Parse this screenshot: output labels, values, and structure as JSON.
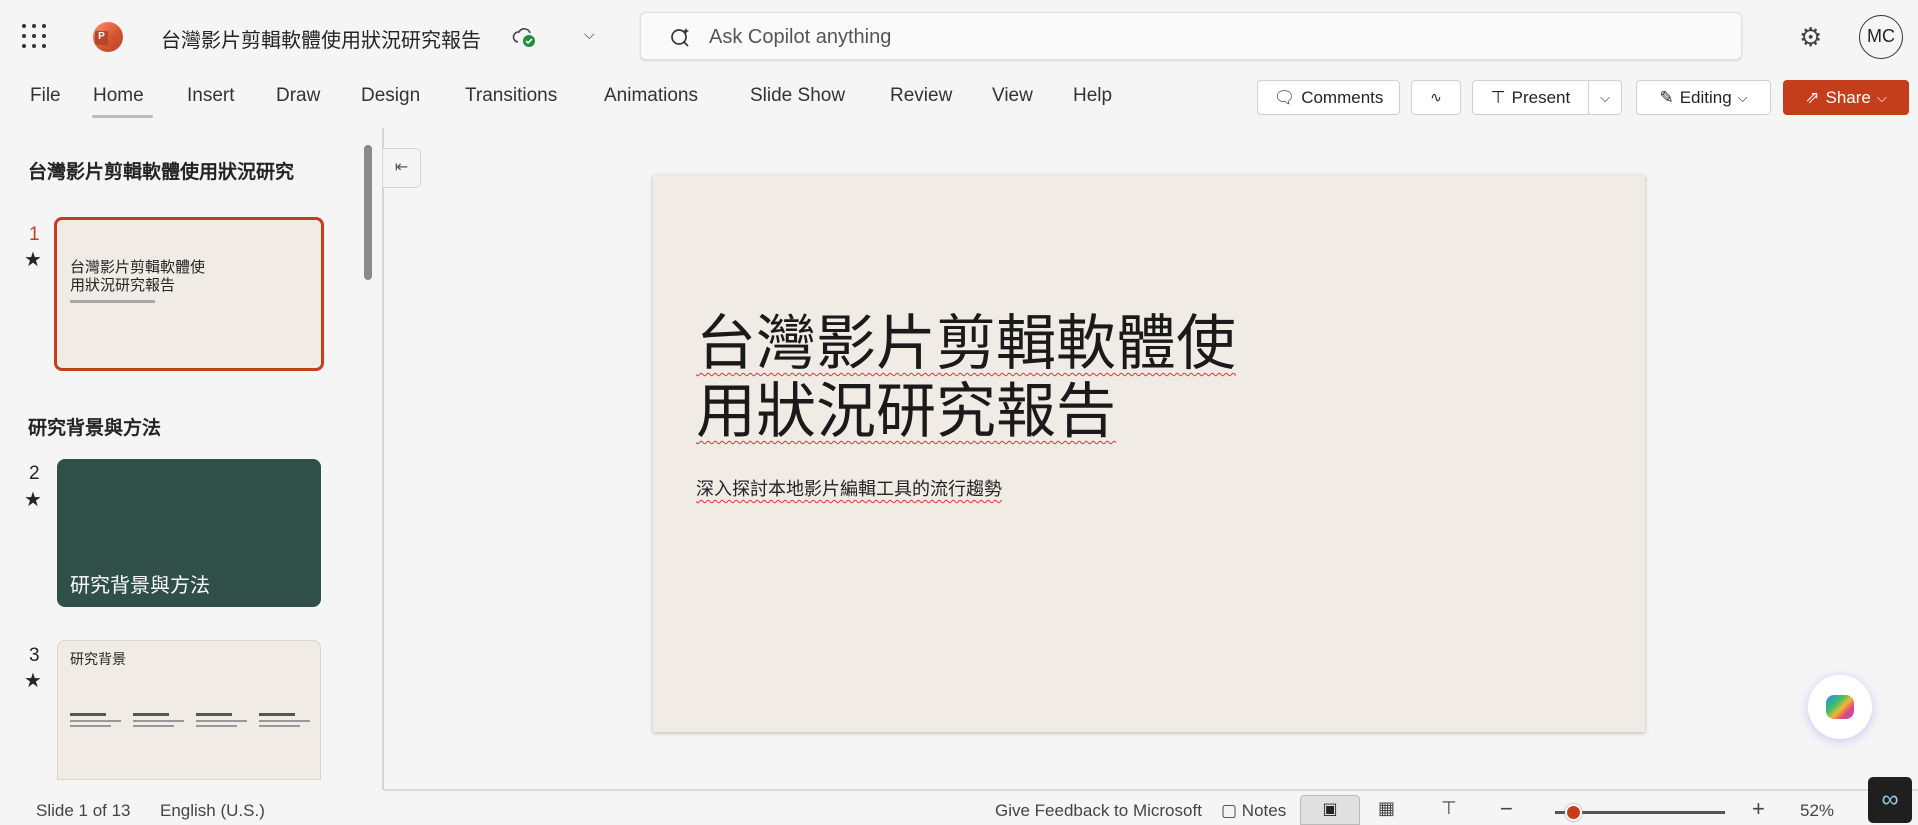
{
  "app": {
    "doc_title": "台灣影片剪輯軟體使用狀況研究報告",
    "search_placeholder": "Ask Copilot anything",
    "avatar": "MC",
    "accent": "#c43e1c"
  },
  "ribbon": {
    "tabs": [
      "File",
      "Home",
      "Insert",
      "Draw",
      "Design",
      "Transitions",
      "Animations",
      "Slide Show",
      "Review",
      "View",
      "Help"
    ],
    "active": "Home",
    "comments": "Comments",
    "present": "Present",
    "editing": "Editing",
    "share": "Share"
  },
  "slides_pane": {
    "sections": [
      "台灣影片剪輯軟體使用狀況研究",
      "研究背景與方法"
    ],
    "slides": [
      {
        "number": "1",
        "title": "台灣影片剪輯軟體使\n用狀況研究報告"
      },
      {
        "number": "2",
        "title": "研究背景與方法"
      },
      {
        "number": "3",
        "title": "研究背景"
      }
    ]
  },
  "slide": {
    "title_line1": "台灣影片剪輯軟體使",
    "title_line2": "用狀況研究報告",
    "subtitle": "深入探討本地影片編輯工具的流行趨勢",
    "background": "#f0ece5"
  },
  "status": {
    "slide_info": "Slide 1 of 13",
    "language": "English (U.S.)",
    "feedback": "Give Feedback to Microsoft",
    "notes": "Notes",
    "zoom": "52%",
    "zoom_level_percent": 52
  }
}
